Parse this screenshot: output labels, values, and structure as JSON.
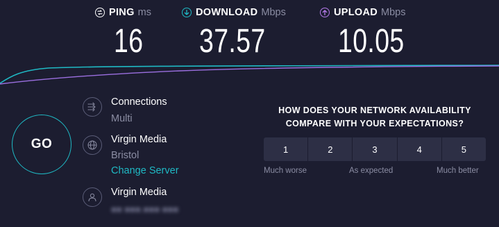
{
  "metrics": {
    "ping": {
      "label": "PING",
      "unit": "ms",
      "value": "16",
      "icon": "ping-icon",
      "color": "#ffffff"
    },
    "download": {
      "label": "DOWNLOAD",
      "unit": "Mbps",
      "value": "37.57",
      "icon": "download-arrow-icon",
      "color": "#1fb9c4"
    },
    "upload": {
      "label": "UPLOAD",
      "unit": "Mbps",
      "value": "10.05",
      "icon": "upload-arrow-icon",
      "color": "#b57bea"
    }
  },
  "go_button": {
    "label": "GO"
  },
  "connections": {
    "title": "Connections",
    "value": "Multi",
    "icon": "connections-icon"
  },
  "server": {
    "provider": "Virgin Media",
    "location": "Bristol",
    "change_label": "Change Server",
    "icon": "globe-icon"
  },
  "user": {
    "isp": "Virgin Media",
    "ip_masked": "■■ ■■■.■■■ ■■■",
    "icon": "user-icon"
  },
  "survey": {
    "question": "HOW DOES YOUR NETWORK AVAILABILITY COMPARE WITH YOUR EXPECTATIONS?",
    "options": [
      "1",
      "2",
      "3",
      "4",
      "5"
    ],
    "label_low": "Much worse",
    "label_mid": "As expected",
    "label_high": "Much better"
  },
  "colors": {
    "background": "#1c1d30",
    "accent_download": "#1fb9c4",
    "accent_upload": "#b57bea",
    "muted_text": "#8b8da3"
  }
}
